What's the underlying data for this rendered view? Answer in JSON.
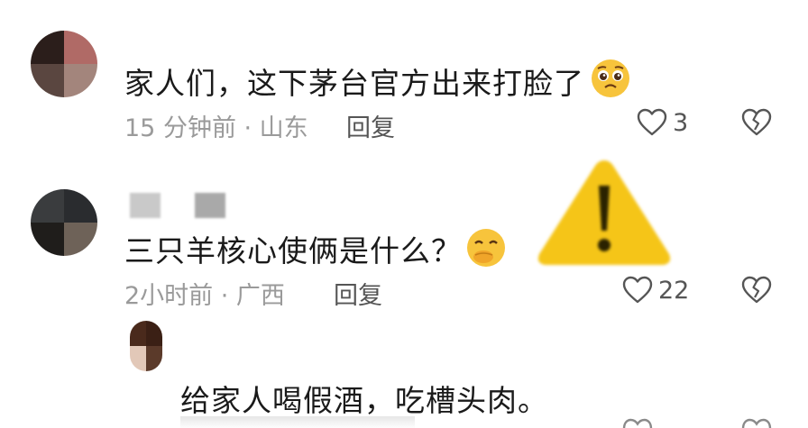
{
  "comments": [
    {
      "text": "家人们，这下茅台官方出来打脸了",
      "emoji_icon": "pleading-face-emoji",
      "time": "15 分钟前 · 山东",
      "reply_label": "回复",
      "likes": "3"
    },
    {
      "text": "三只羊核心使俩是什么？",
      "emoji_icon": "hand-over-mouth-emoji",
      "time": "2小时前 · 广西",
      "reply_label": "回复",
      "likes": "22"
    },
    {
      "text": "给家人喝假酒，吃槽头肉。"
    }
  ],
  "overlay": {
    "icon": "warning-icon",
    "color": "#f5c518"
  }
}
